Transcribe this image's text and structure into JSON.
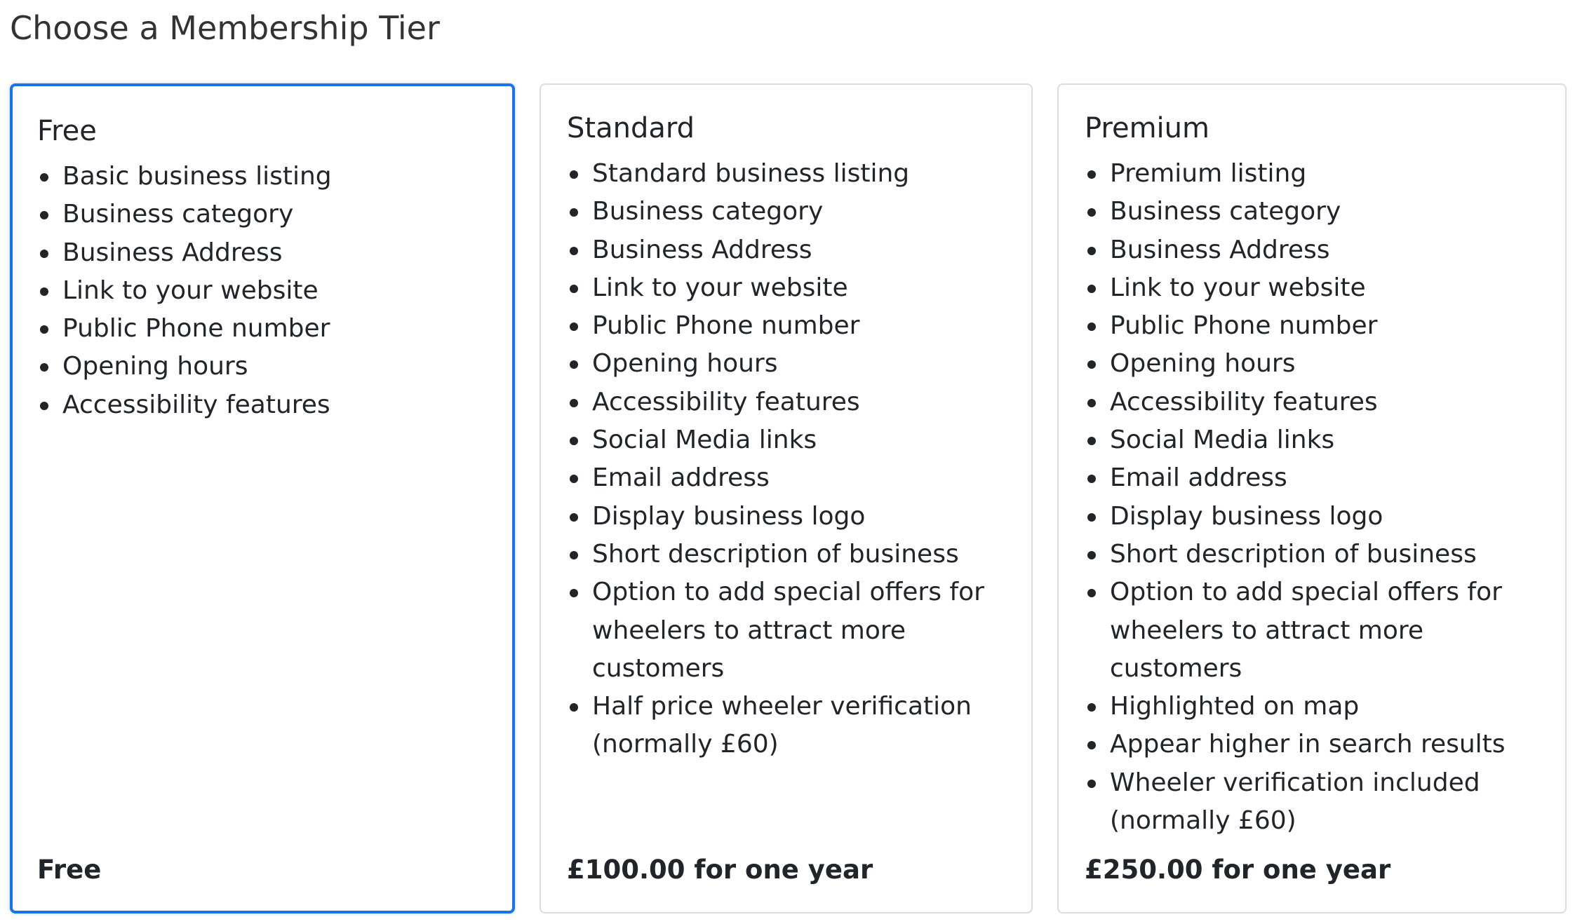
{
  "page": {
    "title": "Choose a Membership Tier"
  },
  "colors": {
    "selected_border": "#1a73e8",
    "card_border": "#dcdcdc",
    "text": "#212529"
  },
  "tiers": [
    {
      "name": "Free",
      "selected": true,
      "features": [
        "Basic business listing",
        "Business category",
        "Business Address",
        "Link to your website",
        "Public Phone number",
        "Opening hours",
        "Accessibility features"
      ],
      "price": "Free"
    },
    {
      "name": "Standard",
      "selected": false,
      "features": [
        "Standard business listing",
        "Business category",
        "Business Address",
        "Link to your website",
        "Public Phone number",
        "Opening hours",
        "Accessibility features",
        "Social Media links",
        "Email address",
        "Display business logo",
        "Short description of business",
        "Option to add special offers for wheelers to attract more customers",
        "Half price wheeler verification (normally £60)"
      ],
      "price": "£100.00 for one year"
    },
    {
      "name": "Premium",
      "selected": false,
      "features": [
        "Premium listing",
        "Business category",
        "Business Address",
        "Link to your website",
        "Public Phone number",
        "Opening hours",
        "Accessibility features",
        "Social Media links",
        "Email address",
        "Display business logo",
        "Short description of business",
        "Option to add special offers for wheelers to attract more customers",
        "Highlighted on map",
        "Appear higher in search results",
        "Wheeler verification included (normally £60)"
      ],
      "price": "£250.00 for one year"
    }
  ]
}
